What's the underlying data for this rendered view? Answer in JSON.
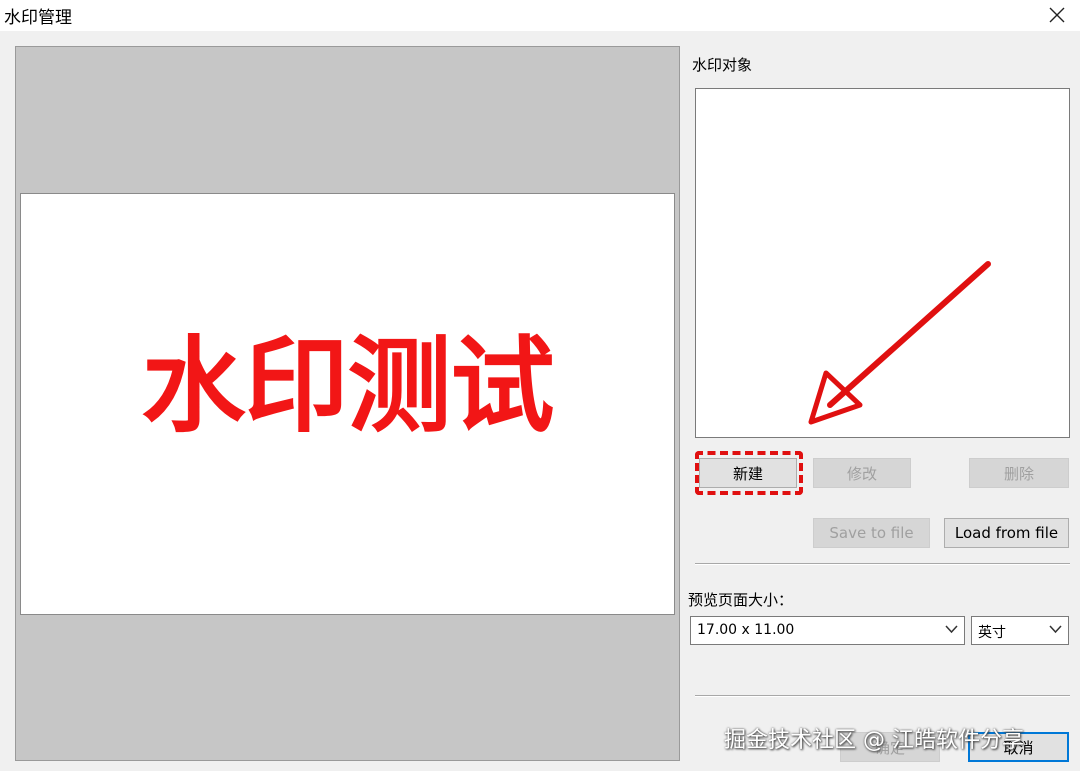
{
  "window": {
    "title": "水印管理",
    "close_icon": "close-icon"
  },
  "preview": {
    "watermark_text": "水印测试",
    "watermark_color": "#f21616"
  },
  "objects": {
    "label": "水印对象",
    "new_label": "新建",
    "edit_label": "修改",
    "delete_label": "删除",
    "save_label": "Save to file",
    "load_label": "Load from file"
  },
  "page_size": {
    "label": "预览页面大小：",
    "size_value": "17.00 x 11.00",
    "unit_value": "英寸"
  },
  "footer": {
    "ok_label": "确定",
    "cancel_label": "取消"
  },
  "overlay": {
    "credit_text": "掘金技术社区 @ 江皓软件分享",
    "annotation_color": "#e01010"
  }
}
